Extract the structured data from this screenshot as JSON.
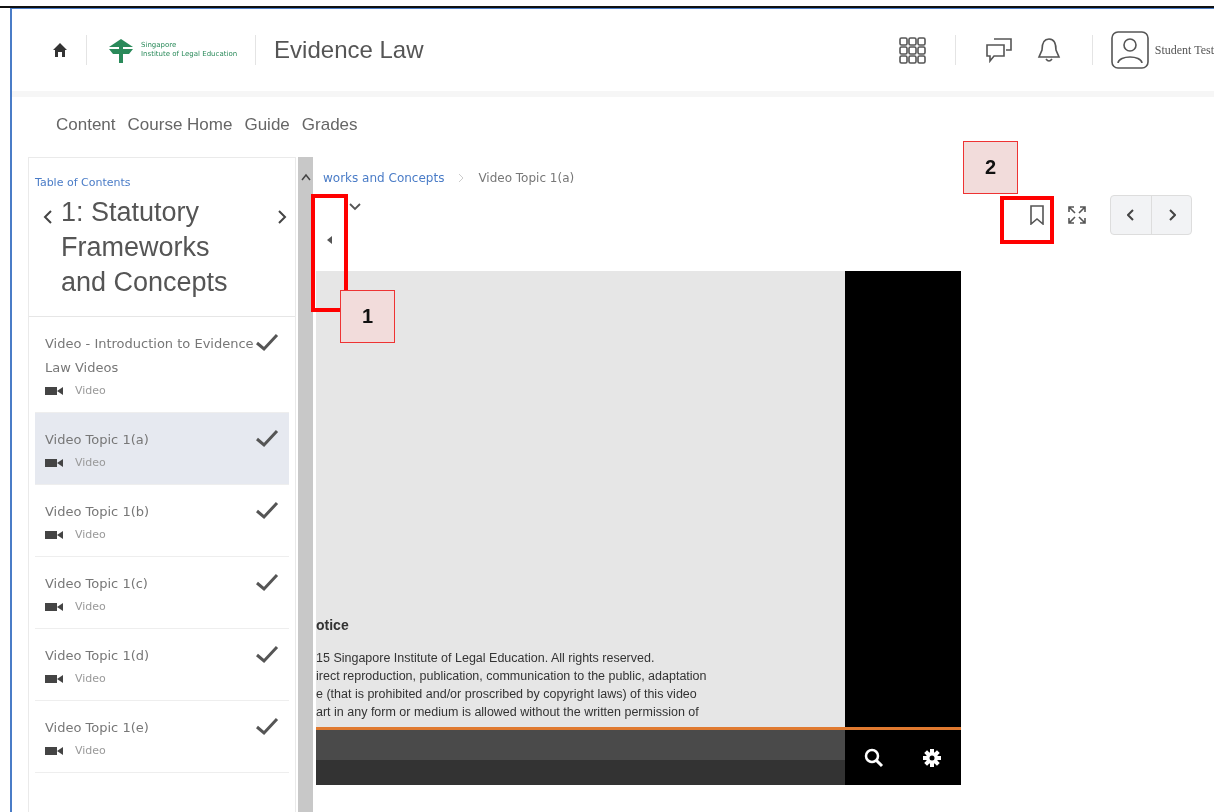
{
  "header": {
    "logo_lines": [
      "Singapore",
      "Institute of Legal Education"
    ],
    "course_title": "Evidence Law",
    "user_name": "Student Test"
  },
  "nav": [
    {
      "label": "Content"
    },
    {
      "label": "Course Home"
    },
    {
      "label": "Guide"
    },
    {
      "label": "Grades"
    }
  ],
  "sidebar": {
    "toc_link": "Table of Contents",
    "module_title": "1: Statutory Frameworks and Concepts",
    "items": [
      {
        "title": "Video - Introduction to Evidence Law Videos",
        "type": "Video",
        "checked": true,
        "selected": false
      },
      {
        "title": "Video Topic 1(a)",
        "type": "Video",
        "checked": true,
        "selected": true
      },
      {
        "title": "Video Topic 1(b)",
        "type": "Video",
        "checked": true,
        "selected": false
      },
      {
        "title": "Video Topic 1(c)",
        "type": "Video",
        "checked": true,
        "selected": false
      },
      {
        "title": "Video Topic 1(d)",
        "type": "Video",
        "checked": true,
        "selected": false
      },
      {
        "title": "Video Topic 1(e)",
        "type": "Video",
        "checked": true,
        "selected": false
      }
    ]
  },
  "breadcrumb": [
    {
      "label": "works and Concepts",
      "link": true
    },
    {
      "label": "Video Topic 1(a)",
      "link": false
    }
  ],
  "video": {
    "notice_heading": "otice",
    "notice_lines": [
      "15 Singapore Institute of Legal Education. All rights reserved.",
      "irect reproduction, publication, communication to the public, adaptation",
      "e (that is prohibited and/or proscribed by copyright laws) of this video",
      "art in any form or medium  is allowed without the written permission of"
    ]
  },
  "callouts": [
    {
      "label": "1"
    },
    {
      "label": "2"
    }
  ]
}
